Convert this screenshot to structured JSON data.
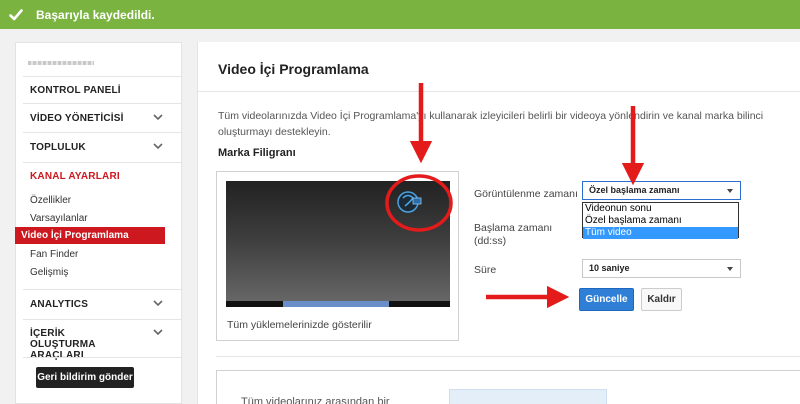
{
  "banner": {
    "message": "Başarıyla kaydedildi.",
    "icon": "checkmark-icon",
    "color": "#7bb340"
  },
  "sidebar": {
    "sections": [
      {
        "label": "KONTROL PANELİ"
      },
      {
        "label": "VİDEO YÖNETİCİSİ"
      },
      {
        "label": "TOPLULUK"
      },
      {
        "label": "KANAL AYARLARI"
      }
    ],
    "channel_items": [
      {
        "label": "Özellikler"
      },
      {
        "label": "Varsayılanlar"
      },
      {
        "label": "Video İçi Programlama"
      },
      {
        "label": "Fan Finder"
      },
      {
        "label": "Gelişmiş"
      }
    ],
    "analytics": "ANALYTICS",
    "creator_tools": "İÇERİK OLUŞTURMA ARAÇLARI",
    "feedback_button": "Geri bildirim gönder",
    "accent": "#cc181e"
  },
  "main": {
    "title": "Video İçi Programlama",
    "description": "Tüm videolarınızda Video İçi Programlama'yı kullanarak izleyicileri belirli bir videoya yönlendirin ve kanal marka bilinci oluşturmayı destekleyin.",
    "section_title": "Marka Filigranı",
    "preview_caption": "Tüm yüklemelerinizde gösterilir",
    "form": {
      "display_time_label": "Görüntülenme zamanı",
      "display_time_value": "Özel başlama zamanı",
      "display_time_options": [
        "Videonun sonu",
        "Özel başlama zamanı",
        "Tüm video"
      ],
      "display_time_highlighted": "Tüm video",
      "start_time_label": "Başlama zamanı (dd:ss)",
      "duration_label": "Süre",
      "duration_value": "10 saniye"
    },
    "update_button": "Güncelle",
    "remove_button": "Kaldır",
    "lower_text": "Tüm videolarınız arasından bir"
  },
  "annotation_color": "#e31b1b"
}
